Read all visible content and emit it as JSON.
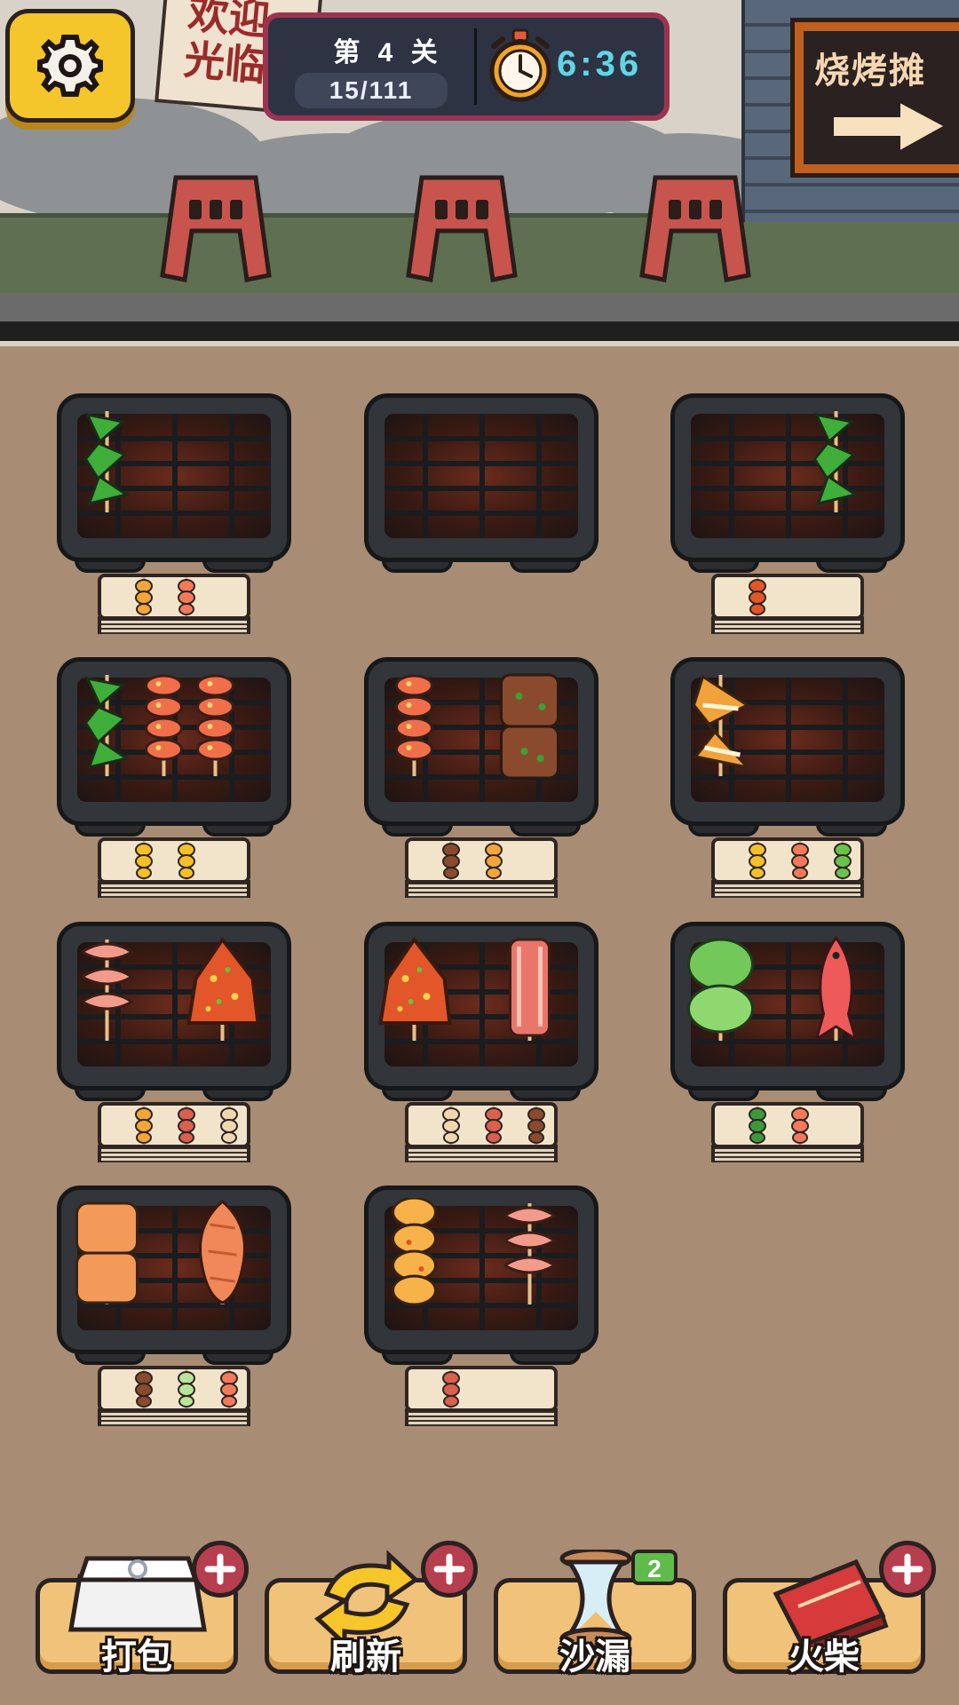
{
  "header": {
    "welcome_sign": [
      "欢迎",
      "光临"
    ],
    "level_title": "第 4 关",
    "progress": "15/111",
    "timer": "6:36",
    "bbq_sign": "烧烤摊"
  },
  "grills": [
    {
      "name": "grill-1",
      "food": [
        "green-pepper-skewer"
      ],
      "plate": [
        "squid-skewer",
        "shrimp-skewer"
      ]
    },
    {
      "name": "grill-2",
      "food": [],
      "plate": []
    },
    {
      "name": "grill-3",
      "food": [
        "",
        "green-pepper-skewer"
      ],
      "plate": [
        "chicken-leg-skewer"
      ]
    },
    {
      "name": "grill-4",
      "food": [
        "green-pepper-skewer",
        "shrimp-skewer",
        "shrimp-skewer"
      ],
      "plate": [
        "corn-skewer",
        "corn-skewer"
      ]
    },
    {
      "name": "grill-5",
      "food": [
        "shrimp-skewer",
        "tofu-skewer"
      ],
      "plate": [
        "sausage-skewer",
        "squid-skewer"
      ]
    },
    {
      "name": "grill-6",
      "food": [
        "orange-squid-skewer"
      ],
      "plate": [
        "corn-skewer",
        "shrimp-skewer",
        "lettuce-skewer"
      ]
    },
    {
      "name": "grill-7",
      "food": [
        "prawn-skewer",
        "chicken-wing-skewer"
      ],
      "plate": [
        "squid-skewer",
        "meat-skewer",
        "mushroom-skewer"
      ]
    },
    {
      "name": "grill-8",
      "food": [
        "chicken-wing-skewer",
        "bacon-skewer"
      ],
      "plate": [
        "mushroom-skewer",
        "meat-skewer",
        "sausage-skewer"
      ]
    },
    {
      "name": "grill-9",
      "food": [
        "lettuce-skewer",
        "fish-skewer"
      ],
      "plate": [
        "leek-skewer",
        "shrimp-skewer"
      ]
    },
    {
      "name": "grill-10",
      "food": [
        "bread-skewer",
        "sausage-skewer"
      ],
      "plate": [
        "tofu-skewer",
        "cabbage-skewer",
        "shrimp-skewer"
      ]
    },
    {
      "name": "grill-11",
      "food": [
        "cheese-skewer",
        "prawn-skewer"
      ],
      "plate": [
        "meat-skewer"
      ]
    }
  ],
  "tools": [
    {
      "name": "pack",
      "label": "打包",
      "icon": "takeout-box-icon",
      "badge": ""
    },
    {
      "name": "refresh",
      "label": "刷新",
      "icon": "refresh-arrows-icon",
      "badge": ""
    },
    {
      "name": "hourglass",
      "label": "沙漏",
      "icon": "hourglass-icon",
      "badge": "2"
    },
    {
      "name": "matches",
      "label": "火柴",
      "icon": "matchbox-icon",
      "badge": ""
    }
  ],
  "colors": {
    "background": "#a88c74",
    "panel": "#2e3344",
    "panel_border": "#9c3350",
    "timer_text": "#5fd6e6",
    "settings_button": "#f4c62c",
    "tool_card": "#f1c27a",
    "plus_button": "#b63e4e"
  }
}
